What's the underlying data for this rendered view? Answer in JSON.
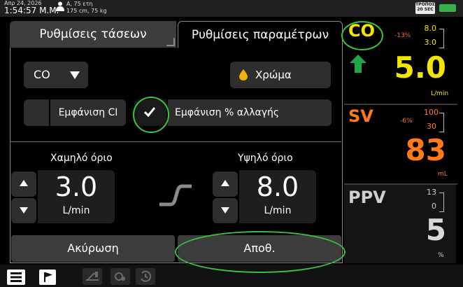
{
  "status_bar": {
    "date": "Απρ 24, 2026",
    "time": "1:54:57 Μ.Μ.",
    "patient_line1": "Α, 75 ετη",
    "patient_line2": "175 cm, 75 kg",
    "mode_line1": "ΤΡΟΠΟΣ",
    "mode_line2": "20 SEC"
  },
  "dialog": {
    "tabs": [
      "Ρυθμίσεις τάσεων",
      "Ρυθμίσεις παραμέτρων"
    ],
    "active_tab": 1,
    "parameter_select": "CO",
    "color_button": "Χρώμα",
    "show_ci": {
      "label": "Εμφάνιση CI",
      "checked": false
    },
    "show_pct_change": {
      "label": "Εμφάνιση % αλλαγής",
      "checked": true
    },
    "low_limit": {
      "title": "Χαμηλό όριο",
      "value": "3.0",
      "unit": "L/min"
    },
    "high_limit": {
      "title": "Υψηλό όριο",
      "value": "8.0",
      "unit": "L/min"
    },
    "cancel_button": "Ακύρωση",
    "save_button": "Αποθ."
  },
  "parameters": [
    {
      "name": "CO",
      "change": "-13%",
      "high": "8.0",
      "low": "3.0",
      "value": "5.0",
      "unit": "L/min",
      "color": "#f2e600",
      "trend": "up-arrow-icon"
    },
    {
      "name": "SV",
      "change": "-6%",
      "high": "100",
      "low": "30",
      "value": "83",
      "unit": "mL",
      "color": "#ff7a1a"
    },
    {
      "name": "PPV",
      "change": "",
      "high": "13",
      "low": "0",
      "value": "5",
      "unit": "%",
      "color": "#d0d0d0"
    }
  ],
  "colors": {
    "co_yellow": "#f2e600",
    "sv_orange": "#ff7a1a",
    "trend_green": "#1fa84a",
    "annotation_green": "#3dc23d",
    "change_red": "#ff6a3a"
  }
}
